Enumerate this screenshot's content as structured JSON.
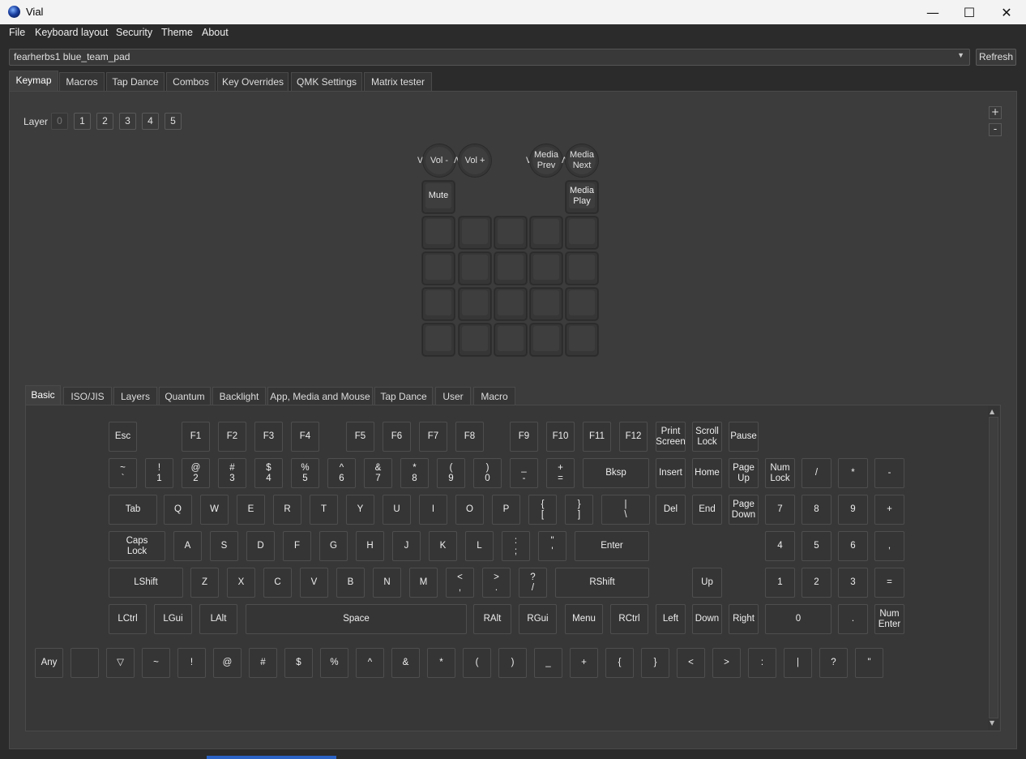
{
  "window": {
    "title": "Vial",
    "minimize": "—",
    "maximize": "☐",
    "close": "✕"
  },
  "menu": [
    "File",
    "Keyboard layout",
    "Security",
    "Theme",
    "About"
  ],
  "device": {
    "selected": "fearherbs1 blue_team_pad",
    "refresh_label": "Refresh"
  },
  "main_tabs": [
    "Keymap",
    "Macros",
    "Tap Dance",
    "Combos",
    "Key Overrides",
    "QMK Settings",
    "Matrix tester"
  ],
  "layer": {
    "label": "Layer",
    "layers": [
      "0",
      "1",
      "2",
      "3",
      "4",
      "5"
    ],
    "zoom_in": "+",
    "zoom_out": "-"
  },
  "keymap": {
    "knobs": [
      "Vol -",
      "Vol +",
      "Media\nPrev",
      "Media\nNext"
    ],
    "row1": [
      "Mute",
      "",
      "",
      "",
      "Media\nPlay"
    ],
    "blank_rows": 4
  },
  "kc_tabs": [
    "Basic",
    "ISO/JIS",
    "Layers",
    "Quantum",
    "Backlight",
    "App, Media and Mouse",
    "Tap Dance",
    "User",
    "Macro"
  ],
  "keys": {
    "fn_row": [
      "Esc",
      "F1",
      "F2",
      "F3",
      "F4",
      "F5",
      "F6",
      "F7",
      "F8",
      "F9",
      "F10",
      "F11",
      "F12",
      "Print\nScreen",
      "Scroll\nLock",
      "Pause"
    ],
    "num_row": [
      "~\n`",
      "!\n1",
      "@\n2",
      "#\n3",
      "$\n4",
      "%\n5",
      "^\n6",
      "&\n7",
      "*\n8",
      "(\n9",
      ")\n0",
      "_\n-",
      "+\n=",
      "Bksp",
      "Insert",
      "Home",
      "Page\nUp",
      "Num\nLock",
      "/",
      "*",
      "-"
    ],
    "tab_row": [
      "Tab",
      "Q",
      "W",
      "E",
      "R",
      "T",
      "Y",
      "U",
      "I",
      "O",
      "P",
      "{\n[",
      "}\n]",
      "|\n\\",
      "Del",
      "End",
      "Page\nDown",
      "7",
      "8",
      "9",
      "+"
    ],
    "caps_row": [
      "Caps\nLock",
      "A",
      "S",
      "D",
      "F",
      "G",
      "H",
      "J",
      "K",
      "L",
      ":\n;",
      "\"\n'",
      "Enter",
      "4",
      "5",
      "6",
      ","
    ],
    "shift_row": [
      "LShift",
      "Z",
      "X",
      "C",
      "V",
      "B",
      "N",
      "M",
      "<\n,",
      ">\n.",
      "?\n/",
      "RShift",
      "Up",
      "1",
      "2",
      "3",
      "="
    ],
    "ctrl_row": [
      "LCtrl",
      "LGui",
      "LAlt",
      "Space",
      "RAlt",
      "RGui",
      "Menu",
      "RCtrl",
      "Left",
      "Down",
      "Right",
      "0",
      ".",
      "Num\nEnter"
    ],
    "extra_row": [
      "Any",
      "",
      "▽",
      "~",
      "!",
      "@",
      "#",
      "$",
      "%",
      "^",
      "&",
      "*",
      "(",
      ")",
      "_",
      "+",
      "{",
      "}",
      "<",
      ">",
      ":",
      "|",
      "?",
      "\""
    ]
  },
  "scroll": {
    "up": "▲",
    "down": "▼"
  }
}
